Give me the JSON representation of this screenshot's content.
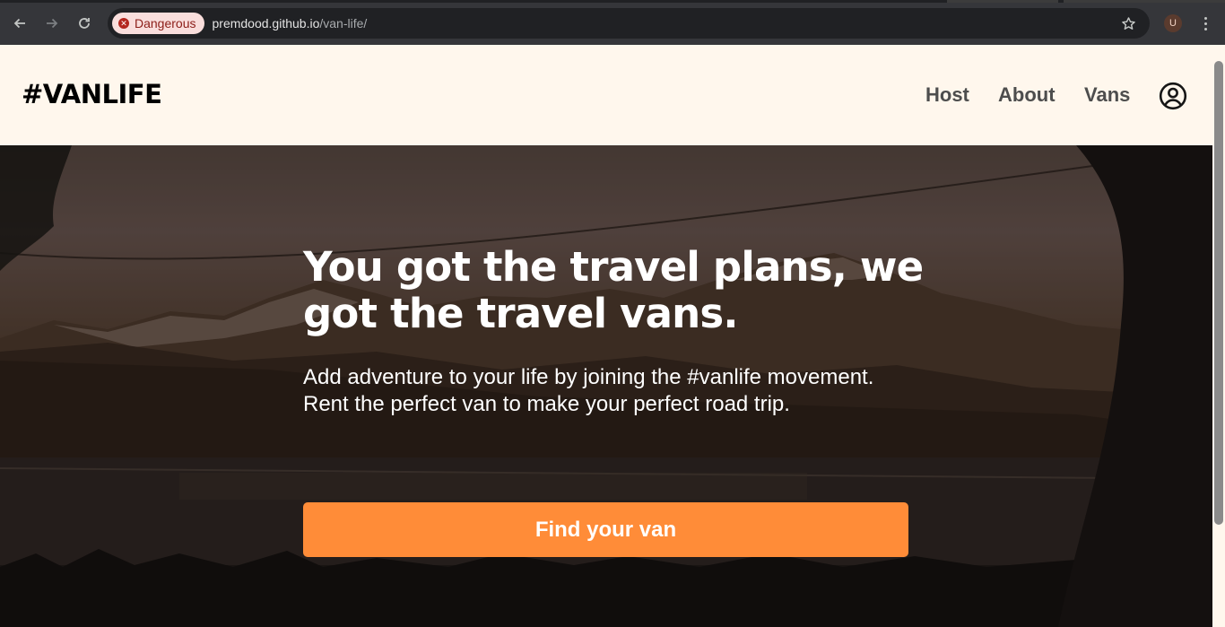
{
  "browser": {
    "security_chip": "Dangerous",
    "url_host": "premdood.github.io",
    "url_path": "/van-life/",
    "profile_initial": "U"
  },
  "site": {
    "logo": "#VANLIFE",
    "nav": [
      {
        "label": "Host"
      },
      {
        "label": "About"
      },
      {
        "label": "Vans"
      }
    ]
  },
  "hero": {
    "title": "You got the travel plans, we got the travel vans.",
    "subtitle_line1": "Add adventure to your life by joining the #vanlife movement.",
    "subtitle_line2": "Rent the perfect van to make your perfect road trip.",
    "cta_label": "Find your van"
  },
  "colors": {
    "page_bg": "#fff7ed",
    "cta": "#ff8c38",
    "danger_chip_bg": "#f9dedc",
    "danger_chip_text": "#8c1d18",
    "chrome_bg": "#35363a"
  },
  "icons": [
    "back-arrow-icon",
    "forward-arrow-icon",
    "reload-icon",
    "danger-icon",
    "bookmark-star-icon",
    "kebab-menu-icon",
    "account-circle-icon"
  ]
}
